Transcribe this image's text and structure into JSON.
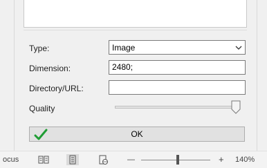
{
  "dialog": {
    "type": {
      "label": "Type:",
      "value": "Image"
    },
    "dimension": {
      "label": "Dimension:",
      "value": "2480;"
    },
    "directory": {
      "label": "Directory/URL:",
      "value": ""
    },
    "quality": {
      "label": "Quality",
      "level_percent": 100
    },
    "ok": {
      "label": "OK",
      "icon": "checkmark-icon",
      "icon_color": "#1f9d34"
    }
  },
  "statusbar": {
    "focus_label": "ocus",
    "zoom_minus": "—",
    "zoom_plus": "+",
    "zoom_level": "140%",
    "icons": [
      "read-mode-icon",
      "print-layout-icon",
      "web-layout-icon"
    ]
  }
}
